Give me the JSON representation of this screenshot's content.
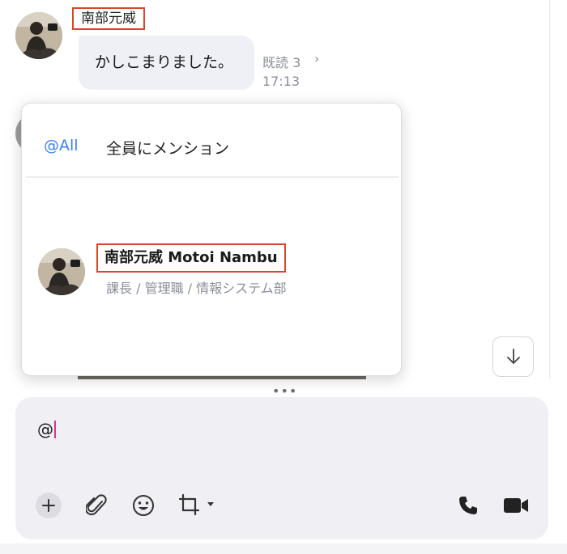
{
  "message": {
    "sender_name": "南部元威",
    "text": "かしこまりました。",
    "read_status": "既読 3",
    "read_chevron": "›",
    "time": "17:13"
  },
  "mention_popup": {
    "all_tag": "@All",
    "all_label": "全員にメンション",
    "members": [
      {
        "name": "南部元威 Motoi Nambu",
        "subtitle": "課長 / 管理職 / 情報システム部"
      }
    ]
  },
  "resize_handle": "•••",
  "composer": {
    "value": "@"
  },
  "icons": {
    "scroll_down": "arrow-down-icon",
    "plus": "plus-icon",
    "attach": "paperclip-icon",
    "emoji": "smiley-icon",
    "crop": "crop-icon",
    "call": "phone-icon",
    "video": "video-camera-icon"
  },
  "colors": {
    "mention_accent": "#3d7ff0",
    "highlight_box": "#d9442c",
    "caret": "#e0338a",
    "bubble_bg": "#eef0f6",
    "composer_bg": "#f0f0f4"
  }
}
